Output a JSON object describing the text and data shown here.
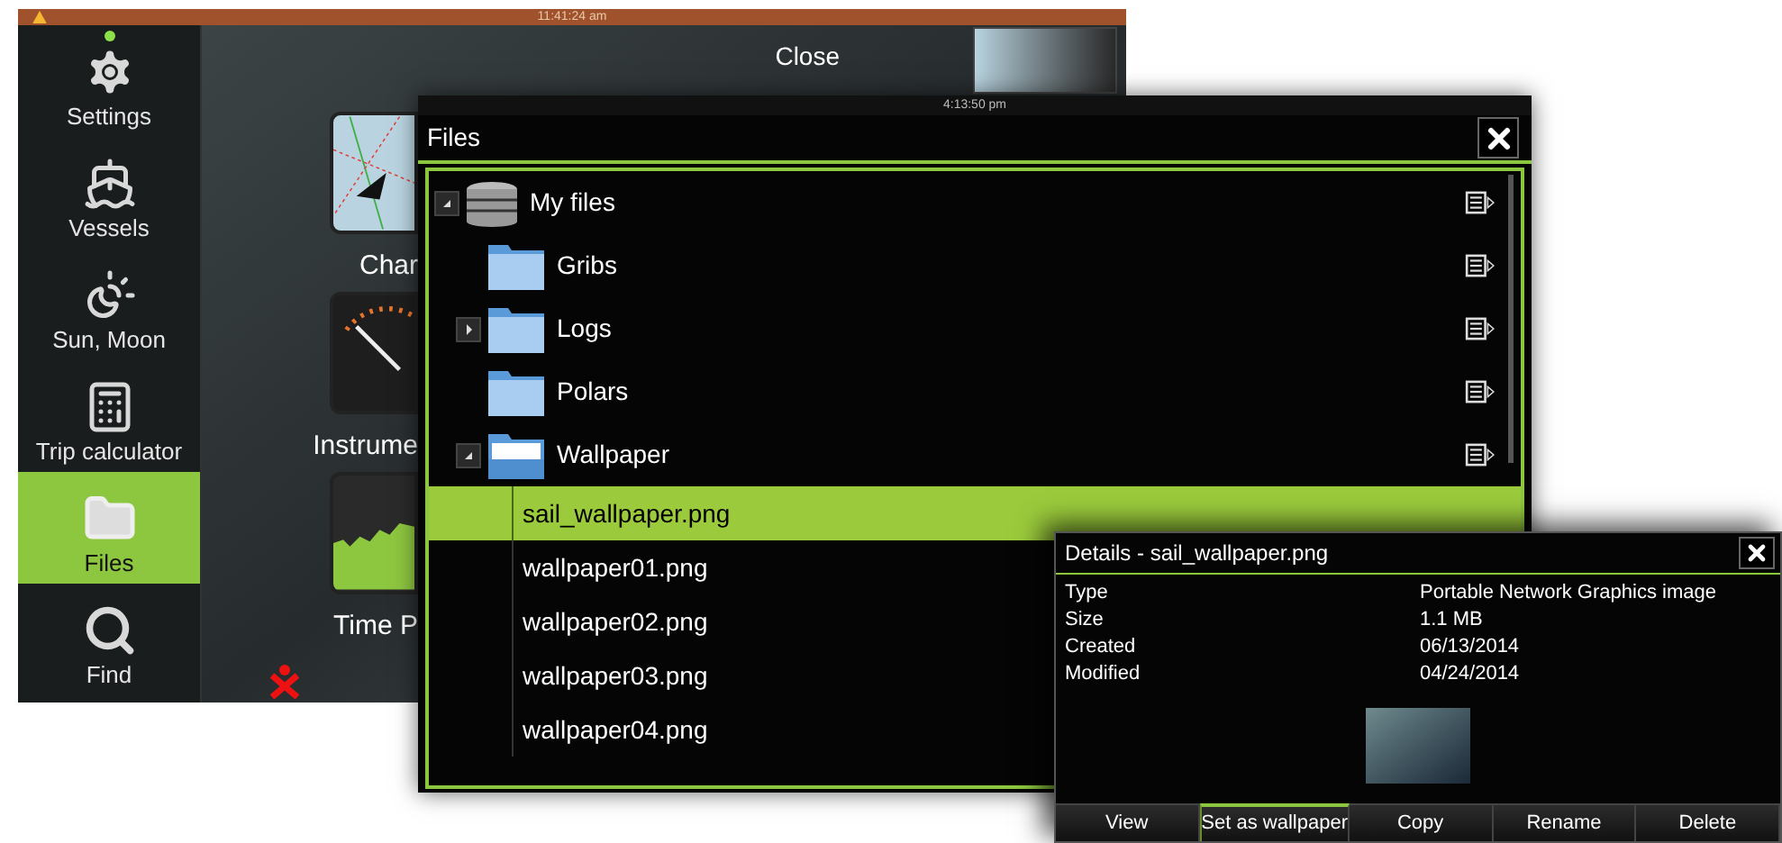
{
  "home_screen": {
    "status_bar": {
      "time": "11:41:24 am"
    },
    "sidebar": {
      "items": [
        {
          "label": "Settings",
          "kind": "settings",
          "selected": false
        },
        {
          "label": "Vessels",
          "kind": "vessels",
          "selected": false
        },
        {
          "label": "Sun, Moon",
          "kind": "astronomy",
          "selected": false
        },
        {
          "label": "Trip calculator",
          "kind": "calculator",
          "selected": false
        },
        {
          "label": "Files",
          "kind": "files",
          "selected": true
        },
        {
          "label": "Find",
          "kind": "find",
          "selected": false
        }
      ]
    },
    "top_bar": {
      "close_label": "Close"
    },
    "tiles": [
      {
        "label": "Char",
        "kind": "chart"
      },
      {
        "label": "Instrume",
        "kind": "gauge"
      },
      {
        "label": "Time P",
        "kind": "graph"
      }
    ]
  },
  "files_dialog": {
    "time": "4:13:50 pm",
    "title": "Files",
    "tree": [
      {
        "name": "My files",
        "kind": "drive",
        "expanded": true,
        "selected": false,
        "children": [
          {
            "name": "Gribs",
            "kind": "folder",
            "selected": false
          },
          {
            "name": "Logs",
            "kind": "folder",
            "expanded": false,
            "selected": false
          },
          {
            "name": "Polars",
            "kind": "folder",
            "selected": false
          },
          {
            "name": "Wallpaper",
            "kind": "folder",
            "expanded": true,
            "selected": false,
            "children": [
              {
                "name": "sail_wallpaper.png",
                "kind": "file",
                "selected": true
              },
              {
                "name": "wallpaper01.png",
                "kind": "file",
                "selected": false
              },
              {
                "name": "wallpaper02.png",
                "kind": "file",
                "selected": false
              },
              {
                "name": "wallpaper03.png",
                "kind": "file",
                "selected": false
              },
              {
                "name": "wallpaper04.png",
                "kind": "file",
                "selected": false
              }
            ]
          }
        ]
      }
    ]
  },
  "details_dialog": {
    "title": "Details - sail_wallpaper.png",
    "properties": [
      {
        "label": "Type",
        "value": "Portable Network Graphics image"
      },
      {
        "label": "Size",
        "value": "1.1 MB"
      },
      {
        "label": "Created",
        "value": "06/13/2014"
      },
      {
        "label": "Modified",
        "value": "04/24/2014"
      }
    ],
    "buttons": [
      {
        "label": "View",
        "selected": false
      },
      {
        "label": "Set as wallpaper",
        "selected": true
      },
      {
        "label": "Copy",
        "selected": false
      },
      {
        "label": "Rename",
        "selected": false
      },
      {
        "label": "Delete",
        "selected": false
      }
    ]
  }
}
